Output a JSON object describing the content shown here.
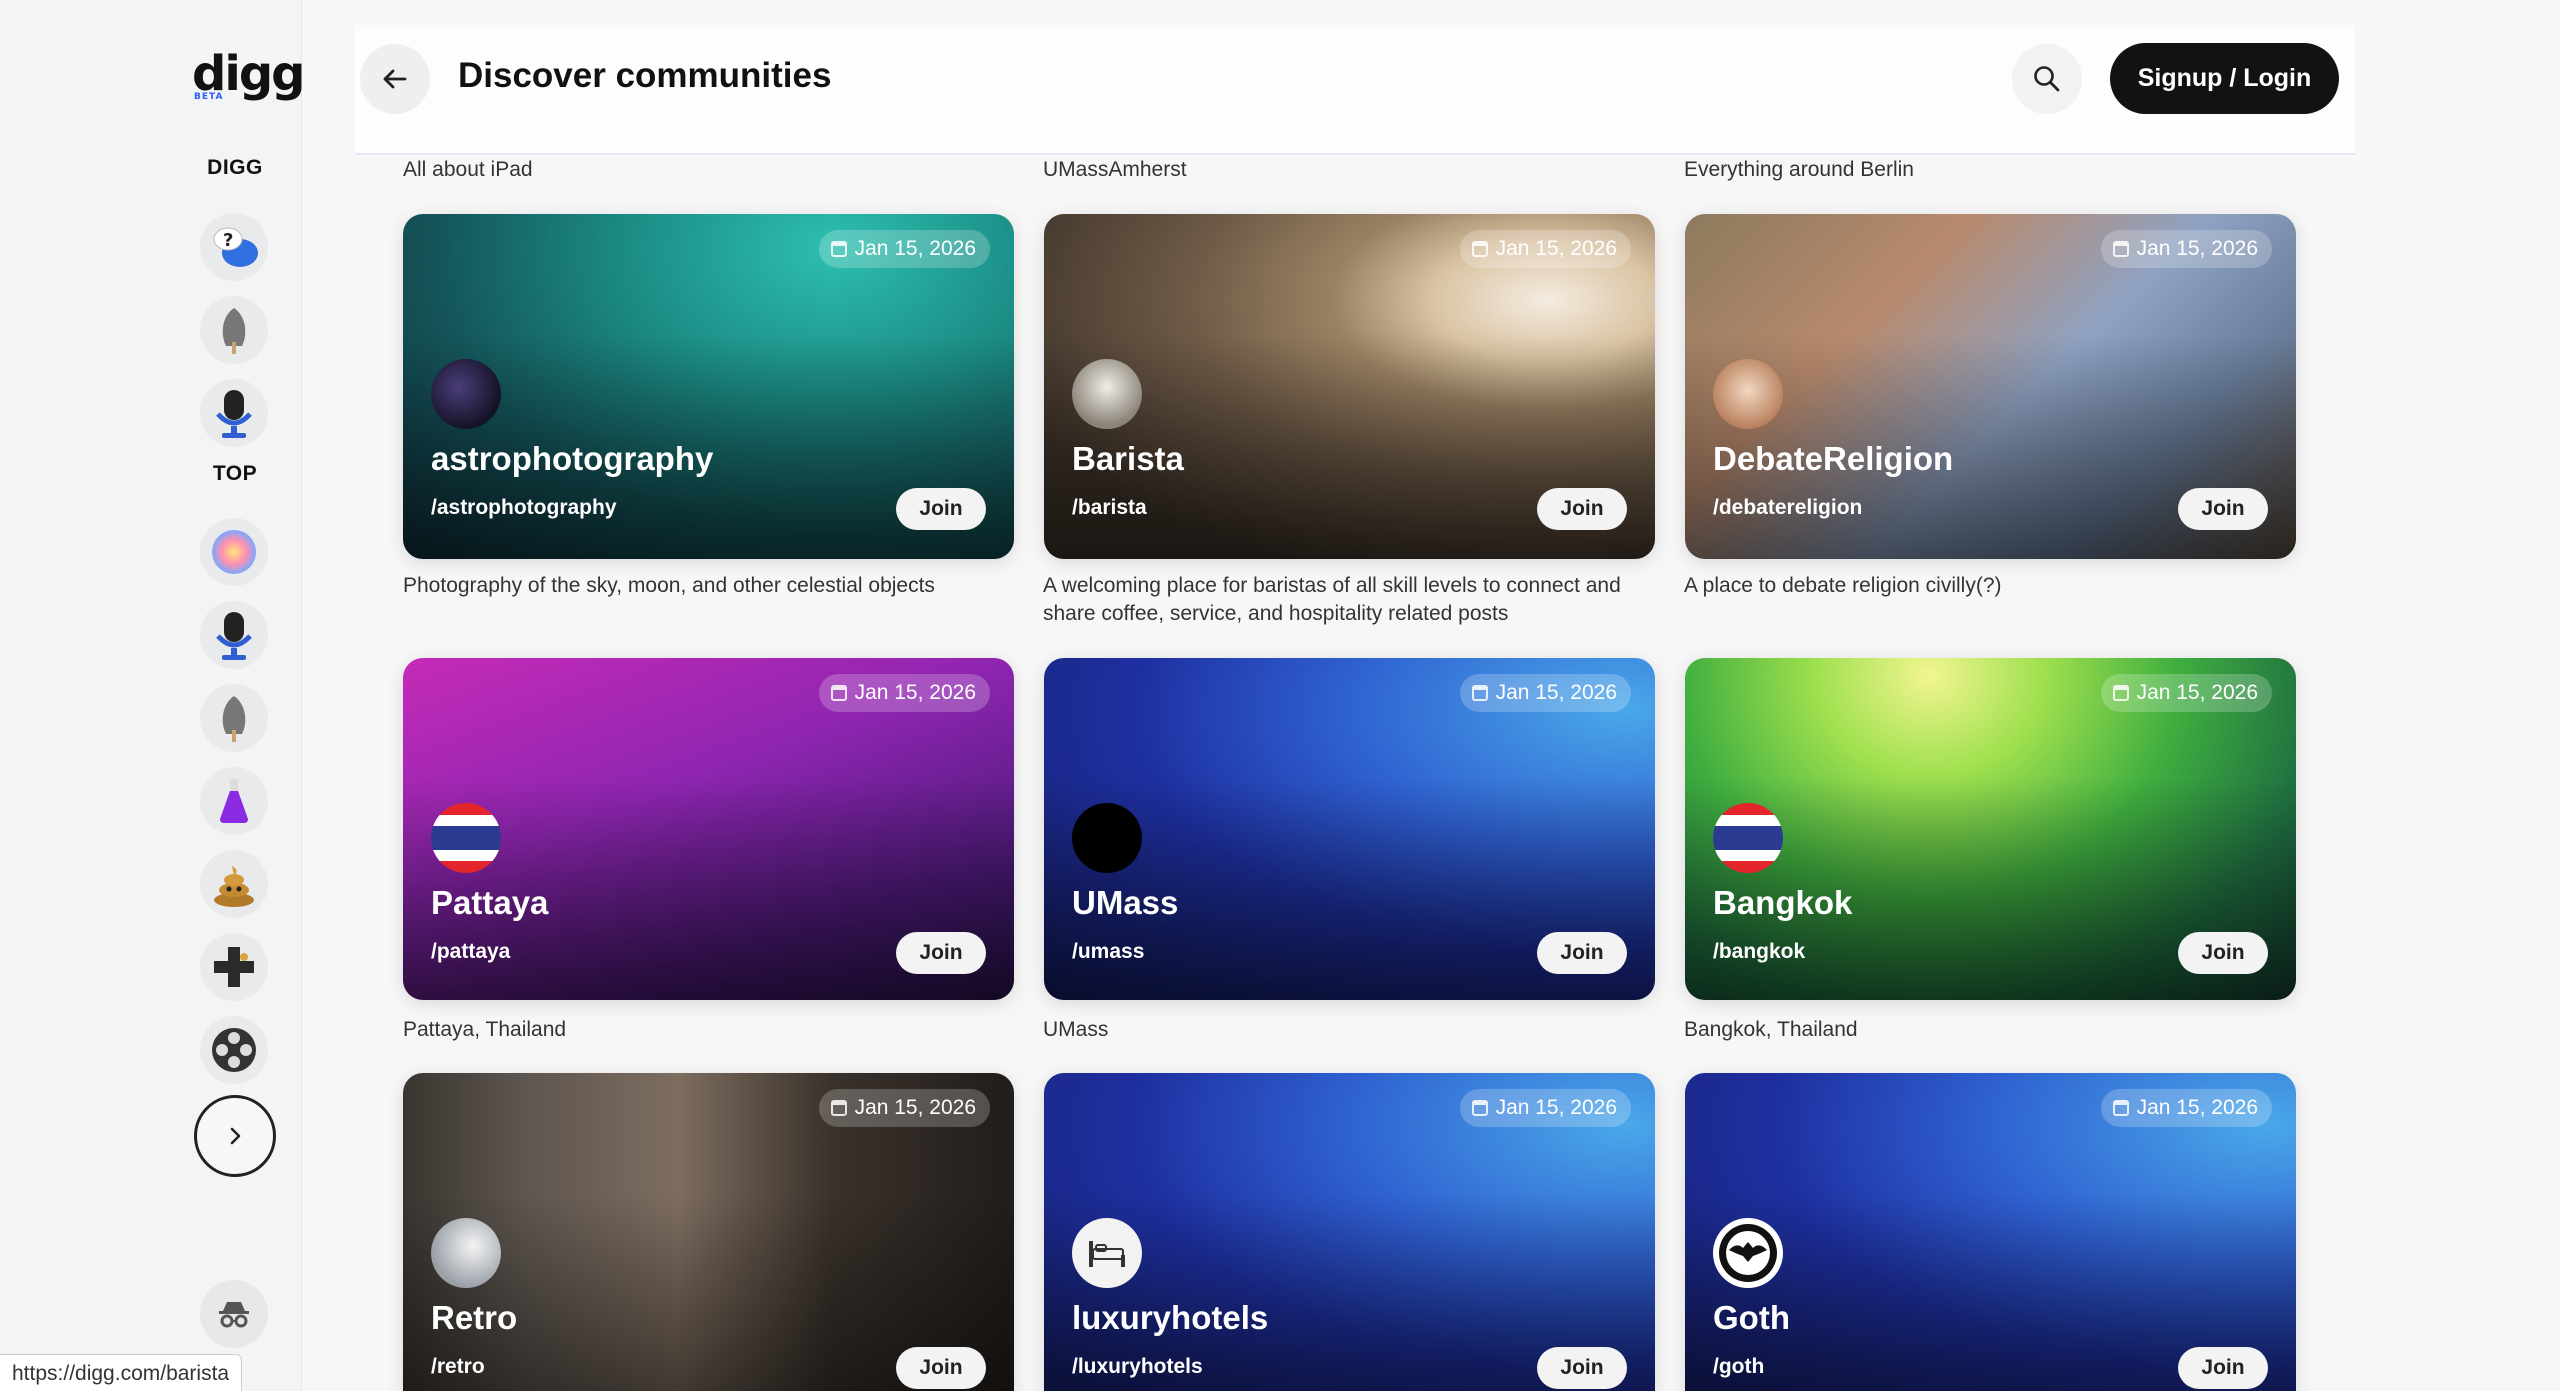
{
  "sidebar": {
    "logo": "digg",
    "logo_badge": "BETA",
    "section_digg": "DIGG",
    "section_top": "TOP",
    "digg_icons": [
      "question-chat-icon",
      "shovel-icon",
      "microphone-icon"
    ],
    "top_icons": [
      "sparkle-orb-icon",
      "microphone-icon",
      "shovel-icon",
      "flask-icon",
      "poop-icon",
      "gamepad-icon",
      "film-reel-icon"
    ],
    "digg_glyphs": [
      "❓",
      "🏹",
      "🎙"
    ],
    "top_glyphs": [
      "🔮",
      "🎙",
      "🏹",
      "⚗",
      "💩",
      "🎮",
      "🎞"
    ]
  },
  "header": {
    "title": "Discover communities",
    "signup_label": "Signup / Login"
  },
  "previous_row_descriptions": [
    "All about iPad",
    "UMassAmherst",
    "Everything around Berlin"
  ],
  "communities": [
    {
      "name": "astrophotography",
      "slug": "/astrophotography",
      "date": "Jan 15, 2026",
      "join": "Join",
      "description": "Photography of the sky, moon, and other celestial objects"
    },
    {
      "name": "Barista",
      "slug": "/barista",
      "date": "Jan 15, 2026",
      "join": "Join",
      "description": "A welcoming place for baristas of all skill levels to connect and share coffee, service, and hospitality related posts"
    },
    {
      "name": "DebateReligion",
      "slug": "/debatereligion",
      "date": "Jan 15, 2026",
      "join": "Join",
      "description": "A place to debate religion civilly(?)"
    },
    {
      "name": "Pattaya",
      "slug": "/pattaya",
      "date": "Jan 15, 2026",
      "join": "Join",
      "description": "Pattaya, Thailand"
    },
    {
      "name": "UMass",
      "slug": "/umass",
      "date": "Jan 15, 2026",
      "join": "Join",
      "description": "UMass"
    },
    {
      "name": "Bangkok",
      "slug": "/bangkok",
      "date": "Jan 15, 2026",
      "join": "Join",
      "description": "Bangkok, Thailand"
    },
    {
      "name": "Retro",
      "slug": "/retro",
      "date": "Jan 15, 2026",
      "join": "Join",
      "description": ""
    },
    {
      "name": "luxuryhotels",
      "slug": "/luxuryhotels",
      "date": "Jan 15, 2026",
      "join": "Join",
      "description": ""
    },
    {
      "name": "Goth",
      "slug": "/goth",
      "date": "Jan 15, 2026",
      "join": "Join",
      "description": ""
    }
  ],
  "status_bar": {
    "url": "https://digg.com/barista"
  }
}
